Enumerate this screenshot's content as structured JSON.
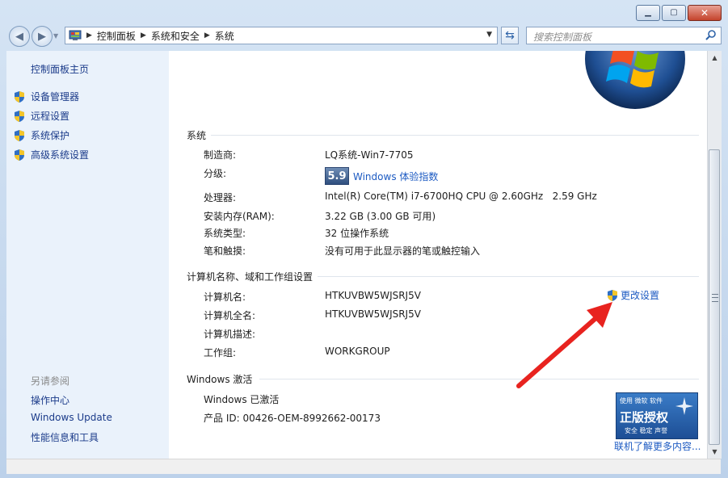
{
  "window": {
    "minimize_icon": "minimize-icon",
    "maximize_icon": "maximize-icon",
    "close_icon": "close-icon"
  },
  "nav": {
    "breadcrumbs": [
      "控制面板",
      "系统和安全",
      "系统"
    ],
    "search_placeholder": "搜索控制面板"
  },
  "sidebar": {
    "home": "控制面板主页",
    "items": [
      {
        "label": "设备管理器",
        "icon": "uac-shield-icon"
      },
      {
        "label": "远程设置",
        "icon": "uac-shield-icon"
      },
      {
        "label": "系统保护",
        "icon": "uac-shield-icon"
      },
      {
        "label": "高级系统设置",
        "icon": "uac-shield-icon"
      }
    ],
    "see_also_title": "另请参阅",
    "see_also": [
      "操作中心",
      "Windows Update",
      "性能信息和工具"
    ]
  },
  "system": {
    "heading": "系统",
    "rows": [
      {
        "label": "制造商:",
        "value": "LQ系统-Win7-7705"
      },
      {
        "label": "分级:",
        "value": ""
      },
      {
        "label": "处理器:",
        "value": "Intel(R) Core(TM) i7-6700HQ CPU @ 2.60GHz   2.59 GHz"
      },
      {
        "label": "安装内存(RAM):",
        "value": "3.22 GB (3.00 GB 可用)"
      },
      {
        "label": "系统类型:",
        "value": "32 位操作系统"
      },
      {
        "label": "笔和触摸:",
        "value": "没有可用于此显示器的笔或触控输入"
      }
    ],
    "rating_score": "5.9",
    "rating_link": "Windows 体验指数"
  },
  "computer": {
    "heading": "计算机名称、域和工作组设置",
    "rows": [
      {
        "label": "计算机名:",
        "value": "HTKUVBW5WJSRJ5V"
      },
      {
        "label": "计算机全名:",
        "value": "HTKUVBW5WJSRJ5V"
      },
      {
        "label": "计算机描述:",
        "value": ""
      },
      {
        "label": "工作组:",
        "value": "WORKGROUP"
      }
    ],
    "change_link": "更改设置"
  },
  "activation": {
    "heading": "Windows 激活",
    "status": "Windows 已激活",
    "product_id": "产品 ID: 00426-OEM-8992662-00173",
    "badge_line1": "使用 微软 软件",
    "badge_line2": "正版授权",
    "badge_line3": "安全 稳定 声誉",
    "more_link": "联机了解更多内容..."
  },
  "colors": {
    "link": "#1c5ac2",
    "sidebar_bg": "#eaf2fb",
    "annotation_arrow": "#e8231f"
  }
}
